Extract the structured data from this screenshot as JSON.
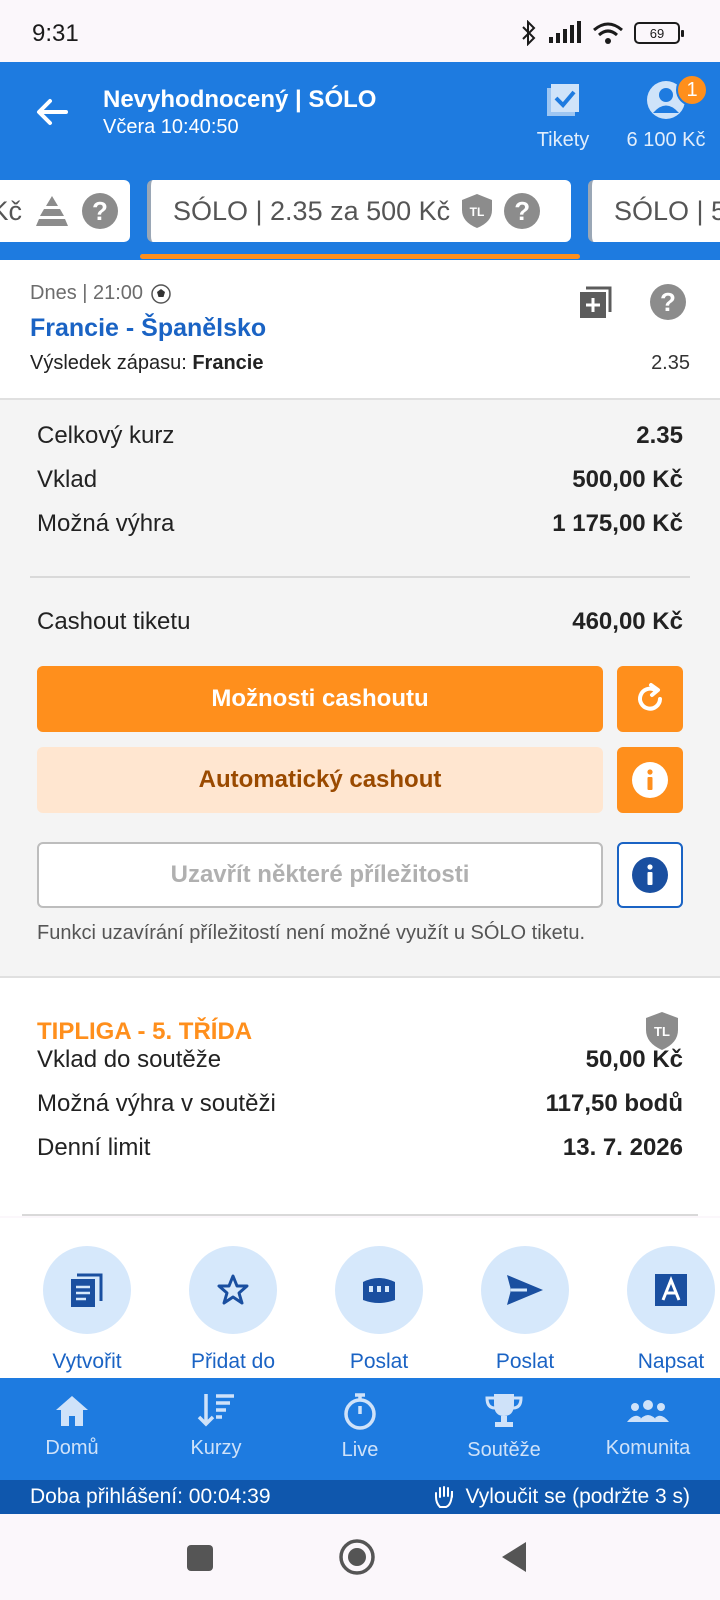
{
  "status_bar": {
    "time": "9:31",
    "battery": "69"
  },
  "header": {
    "title": "Nevyhodnocený | SÓLO",
    "subtitle": "Včera 10:40:50",
    "tickets_label": "Tikety",
    "balance": "6 100 Kč",
    "badge": "1"
  },
  "tabs": {
    "left": "Kč",
    "center": "SÓLO  | 2.35 za 500 Kč",
    "right": "SÓLO  | 5",
    "shield": "TL"
  },
  "match": {
    "time": "Dnes  |  21:00",
    "name": "Francie - Španělsko",
    "result_label": "Výsledek zápasu: ",
    "result_value": "Francie",
    "odd": "2.35"
  },
  "summary": {
    "total_odds_label": "Celkový kurz",
    "total_odds": "2.35",
    "stake_label": "Vklad",
    "stake": "500,00 Kč",
    "possible_win_label": "Možná výhra",
    "possible_win": "1 175,00 Kč",
    "cashout_label": "Cashout tiketu",
    "cashout": "460,00 Kč",
    "cashout_options_btn": "Možnosti cashoutu",
    "auto_cashout_btn": "Automatický cashout",
    "close_btn": "Uzavřít některé příležitosti",
    "note": "Funkci uzavírání příležitostí není možné využít u SÓLO tiketu."
  },
  "league": {
    "title": "TIPLIGA - 5. TŘÍDA",
    "shield": "TL",
    "stake_label": "Vklad do soutěže",
    "stake": "50,00 Kč",
    "win_label": "Možná výhra v soutěži",
    "win": "117,50 bodů",
    "limit_label": "Denní limit",
    "limit": "13. 7. 2026"
  },
  "actions": [
    {
      "label": "Vytvořit",
      "icon": "document-icon"
    },
    {
      "label": "Přidat do",
      "icon": "star-icon"
    },
    {
      "label": "Poslat",
      "icon": "stadium-icon"
    },
    {
      "label": "Poslat",
      "icon": "send-icon"
    },
    {
      "label": "Napsat",
      "icon": "text-icon"
    }
  ],
  "nav": [
    {
      "label": "Domů",
      "icon": "home-icon"
    },
    {
      "label": "Kurzy",
      "icon": "sort-icon"
    },
    {
      "label": "Live",
      "icon": "stopwatch-icon"
    },
    {
      "label": "Soutěže",
      "icon": "trophy-icon"
    },
    {
      "label": "Komunita",
      "icon": "community-icon"
    }
  ],
  "session": {
    "login_time": "Doba přihlášení: 00:04:39",
    "self_exclude": "Vyloučit se (podržte 3 s)"
  },
  "colors": {
    "primary_blue": "#1e7be0",
    "accent_orange": "#ff8f1c",
    "link_blue": "#1a63c4"
  }
}
